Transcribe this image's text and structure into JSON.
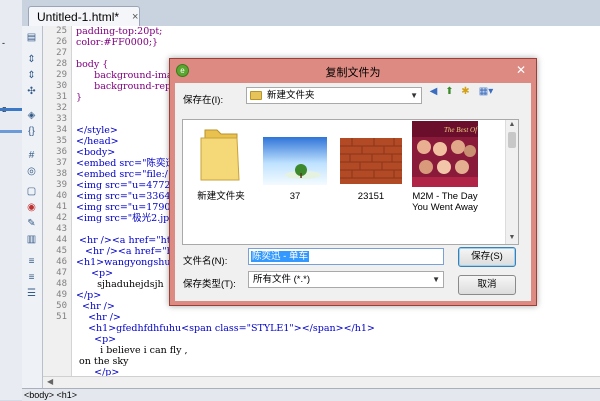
{
  "window": {
    "tab_title": "Untitled-1.html*",
    "tab_close": "×"
  },
  "left_strip": {
    "frag1": "-",
    "frag2": "s"
  },
  "status_bar": {
    "text": "<body> <h1>"
  },
  "editor": {
    "line_numbers": [
      "25",
      "26",
      "27",
      "28",
      "29",
      "30",
      "31",
      "32",
      "33",
      "34",
      "35",
      "36",
      "37",
      "38",
      "39",
      "40",
      "41",
      "42",
      "43",
      "44",
      "45",
      "46",
      "47",
      "48",
      "49",
      "50",
      "51"
    ],
    "lines": [
      "padding-top:20pt;",
      "color:#FF0000;}",
      "",
      "body {",
      "      background-imag",
      "      background-repe",
      "}",
      "",
      "",
      "</style>",
      "</head>",
      "<body>",
      "<embed src=\"陈奕迅",
      "<embed src=\"file:/",
      "<img src=\"u=4772538",
      "<img src=\"u=3364100",
      "<img src=\"u=1790777",
      "<img src=\"极光2.jpg",
      "",
      " <hr /><a href=\"htt",
      "   <hr /><a href=\"ht",
      "<h1>wangyongshuai</",
      "     <p>",
      "       sjhaduhejdsjh",
      "</p>",
      "  <hr />",
      "    <hr />",
      "    <h1>gfedhfdhfuhu<span class=\"STYLE1\"></span></h1>",
      "      <p>",
      "        i believe i can fly ,",
      " on the sky",
      "      </p>",
      "      </..."
    ]
  },
  "dialog": {
    "title": "复制文件为",
    "close": "✕",
    "save_in_label": "保存在(I):",
    "save_in_value": "新建文件夹",
    "files": [
      {
        "name": "新建文件夹",
        "icon": "folder-icon"
      },
      {
        "name": "37",
        "icon": "image-sky-tree"
      },
      {
        "name": "23151",
        "icon": "image-brick"
      },
      {
        "name": "M2M - The Day You Went Away",
        "icon": "image-album"
      }
    ],
    "album_text": "The Best Of",
    "filename_label": "文件名(N):",
    "filename_value": "陈奕迅 - 单车",
    "filetype_label": "保存类型(T):",
    "filetype_value": "所有文件 (*.*)",
    "save_button": "保存(S)",
    "cancel_button": "取消"
  }
}
